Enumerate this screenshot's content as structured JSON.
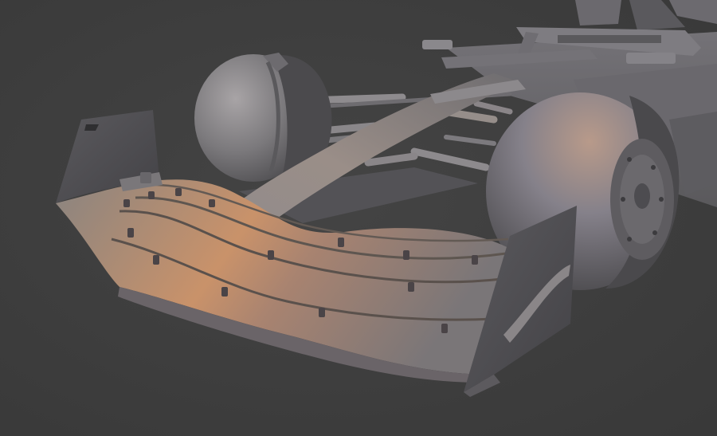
{
  "viewport": {
    "background_color": "#3e3e3e",
    "model_base_color": "#7d7b80",
    "highlight_color": "#c9926a",
    "shadow_color": "#2f2f31"
  },
  "scene": {
    "object": "open-wheel-race-car-front",
    "parts": [
      "front-wing",
      "left-endplate",
      "right-endplate",
      "nose-cone",
      "left-front-tyre",
      "right-front-tyre",
      "wheel-hub",
      "suspension-arms",
      "sidepod",
      "halo",
      "airbox"
    ]
  }
}
